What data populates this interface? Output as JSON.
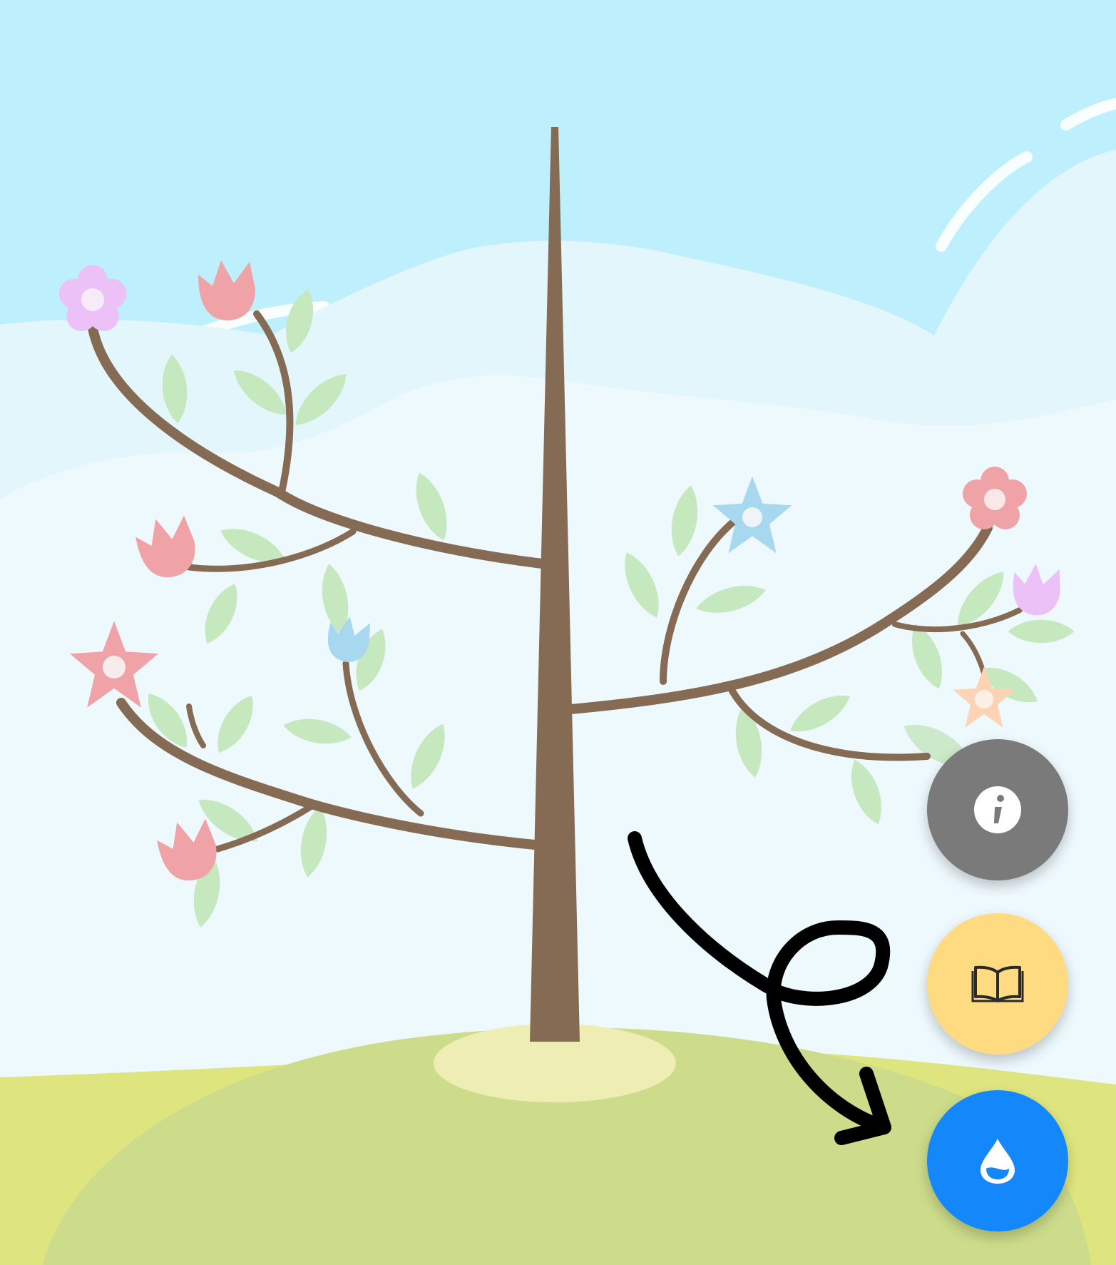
{
  "scene": {
    "sky_color": "#bdeffc",
    "far_hill_color": "#e9f8fc",
    "near_hill_color": "#eef9fd",
    "grass_back_color": "#dfe57e",
    "grass_front_color": "#cddc8b",
    "soil_patch_color": "#eeedb4",
    "trunk_color": "#856a54",
    "leaf_color": "#c6e8bf"
  },
  "flowers": [
    {
      "name": "violet-star-flower",
      "color": "#ecc1f7"
    },
    {
      "name": "pink-tulip",
      "color": "#f0a3a6"
    },
    {
      "name": "blue-star-flower",
      "color": "#a8d7f0"
    },
    {
      "name": "peach-star-flower",
      "color": "#fdd3b5"
    }
  ],
  "buttons": {
    "info": {
      "icon": "info-icon",
      "bg": "#7a7a7a"
    },
    "book": {
      "icon": "open-book-icon",
      "bg": "#fedb80"
    },
    "water": {
      "icon": "water-drop-icon",
      "bg": "#1487fb"
    }
  },
  "annotation": {
    "icon": "hand-drawn-arrow-icon",
    "color": "#000000"
  }
}
